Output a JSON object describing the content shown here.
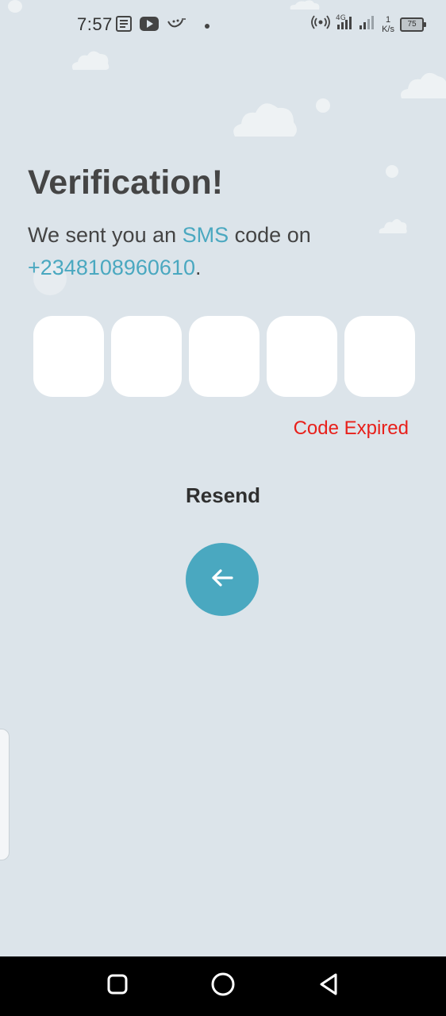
{
  "status_bar": {
    "time": "7:57",
    "network_speed_value": "1",
    "network_speed_unit": "K/s",
    "network_type": "4G",
    "battery_level": "75",
    "icons": [
      "notes-icon",
      "youtube-icon",
      "app-notification-icon",
      "hotspot-icon",
      "signal-4g-icon",
      "signal-icon",
      "battery-icon"
    ]
  },
  "verification": {
    "title": "Verification!",
    "subtitle_prefix": "We sent you an ",
    "subtitle_accent": "SMS",
    "subtitle_middle": " code on",
    "phone": "+2348108960610",
    "phone_suffix": ".",
    "code_length": 5,
    "code_values": [
      "",
      "",
      "",
      "",
      ""
    ],
    "error_text": "Code Expired",
    "resend_label": "Resend",
    "back_button_icon": "arrow-left-icon"
  },
  "colors": {
    "background": "#dce4ea",
    "accent": "#4aa8c0",
    "error": "#e8201b",
    "title": "#454545",
    "code_box": "#ffffff"
  },
  "nav_bar": {
    "buttons": [
      "recents-square-icon",
      "home-circle-icon",
      "back-triangle-icon"
    ]
  }
}
